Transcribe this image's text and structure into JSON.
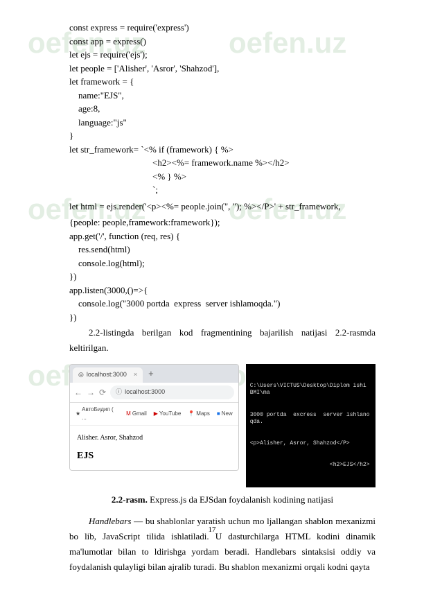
{
  "watermark": "oefen.uz",
  "code": {
    "l1": "const express = require('express')",
    "l2": "const app = express()",
    "l3": "let ejs = require('ejs');",
    "l4": "let people = ['Alisher', 'Asror', 'Shahzod'],",
    "l5": "let framework = {",
    "l6": "    name:\"EJS\",",
    "l7": "    age:8,",
    "l8": "    language:\"js\"",
    "l9": "}",
    "l10": "let str_framework= `<% if (framework) { %>",
    "l11": "<h2><%= framework.name %></h2>",
    "l12": "<% } %>",
    "l13": "`;",
    "l14_pre": "let  html  =  ejs.render('<p><%=  people.join(\", \");  %></P>'  +  str_framework,",
    "l14_post": "{people: people,framework:framework});",
    "l15": "app.get('/', function (req, res) {",
    "l16": "    res.send(html)",
    "l17": "    console.log(html);",
    "l18": "})",
    "l19": "app.listen(3000,()=>{",
    "l20": "    console.log(\"3000 portda  express  server ishlamoqda.\")",
    "l21": "})"
  },
  "paragraph1": "2.2-listingda   berilgan   kod   fragmentining   bajarilish   natijasi   2.2-rasmda keltirilgan.",
  "browser": {
    "tab_title": "localhost:3000",
    "url": "localhost:3000",
    "bookmarks": {
      "b1": "AвтоБидип ( ...",
      "b2": "Gmail",
      "b3": "YouTube",
      "b4": "Maps",
      "b5": "New"
    },
    "page_names": "Alisher. Asror, Shahzod",
    "page_heading": "EJS"
  },
  "terminal": {
    "line1": "C:\\Users\\VICTUS\\Desktop\\Diplom ishi BMI\\ma",
    "line2": "3000 portda  excress  server ishlanoqda.",
    "line3": "<p>Alisher, Asror, Shahzod</P>",
    "line4": "                        <h2>EJS</h2>"
  },
  "caption": {
    "bold": "2.2-rasm.",
    "text": " Express.js da EJSdan foydalanish kodining natijasi"
  },
  "paragraph2": {
    "italic": "Handlebars",
    "text": "  —  bu shablonlar yaratish uchun mo ljallangan shablon mexanizmi bo lib,   JavaScript   tilida   ishlatiladi.   U   dasturchilarga   HTML   kodini   dinamik ma'lumotlar   bilan   to ldirishga   yordam   beradi.   Handlebars   sintaksisi   oddiy   va foydalanish qulayligi bilan ajralib turadi. Bu shablon mexanizmi orqali kodni qayta"
  },
  "page_number": "17"
}
